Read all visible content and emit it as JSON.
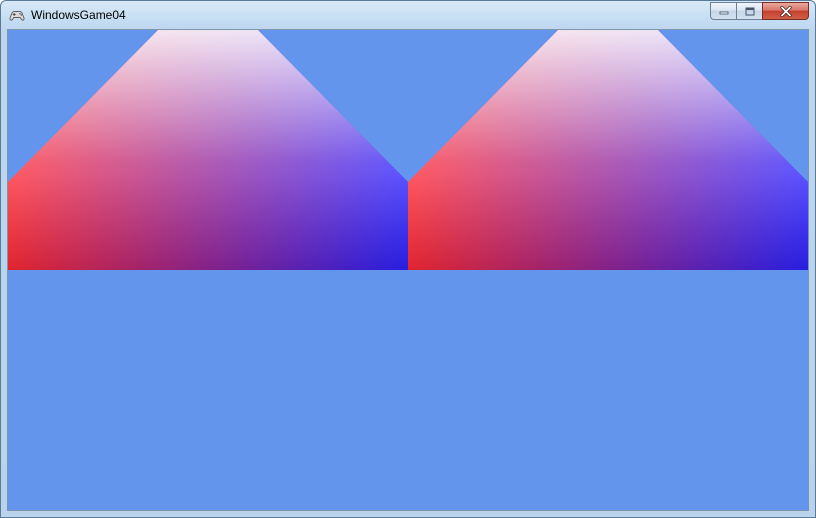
{
  "window": {
    "title": "WindowsGame04",
    "icon": "gamepad-icon"
  },
  "caption_buttons": {
    "minimize": "minimize-icon",
    "maximize": "maximize-icon",
    "close": "close-icon"
  },
  "game": {
    "clear_color": "#6495ed",
    "shape_colors": {
      "apex": "#ffffff",
      "bottom_left": "#e8001f",
      "bottom_right": "#2a00d8",
      "middle_left": "#ff4a5a",
      "middle_right": "#4c4aff"
    }
  }
}
